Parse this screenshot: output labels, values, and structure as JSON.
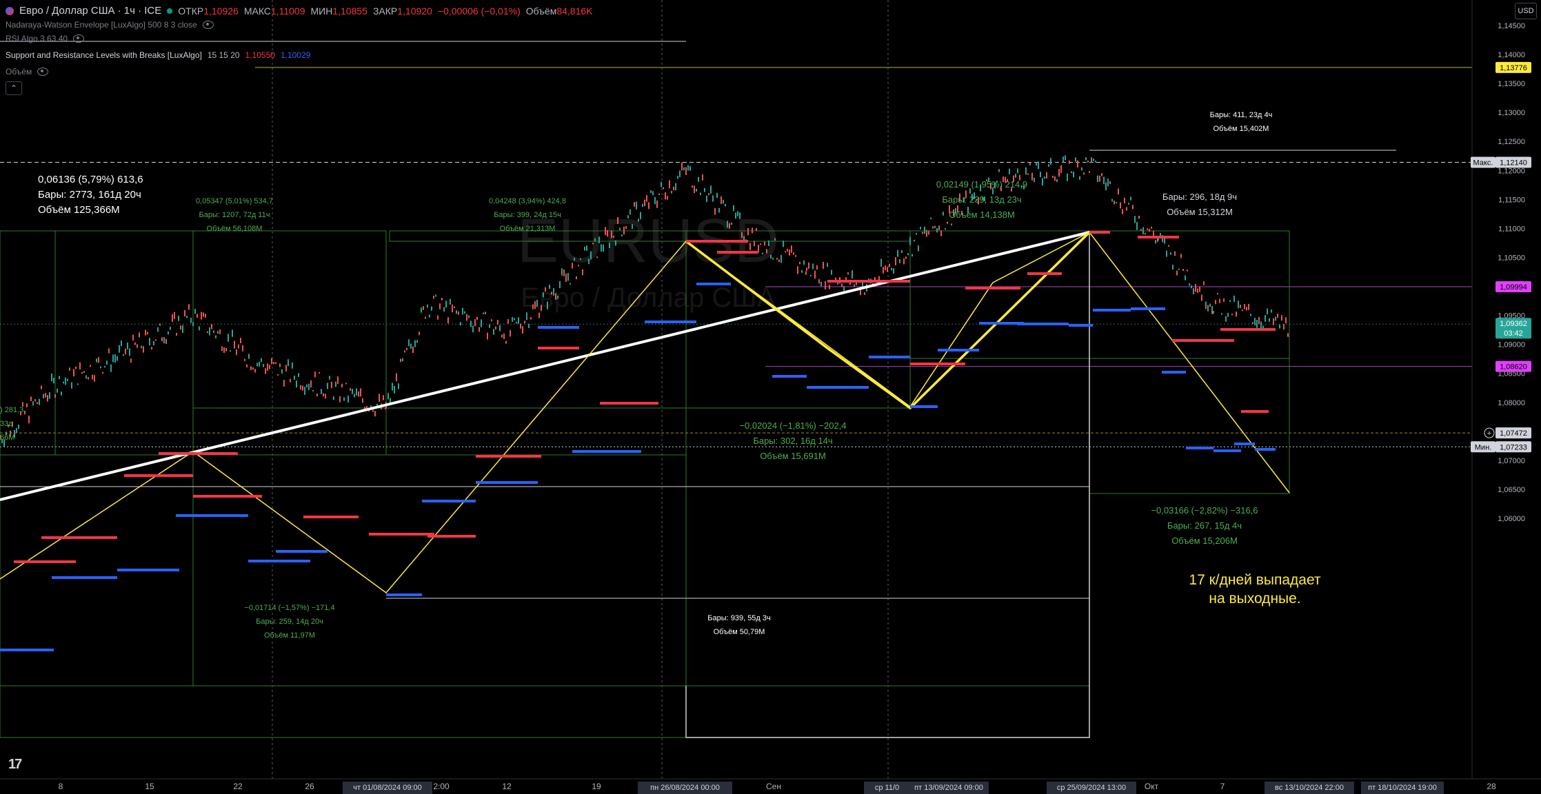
{
  "legend": {
    "symbol_title": "Евро / Доллар США · 1ч · ICE",
    "open_label": "ОТКР",
    "open_value": "1,10926",
    "high_label": "МАКС",
    "high_value": "1,11009",
    "low_label": "МИН",
    "low_value": "1,10855",
    "close_label": "ЗАКР",
    "close_value": "1,10920",
    "change_value": "−0,00006 (−0,01%)",
    "volume_label": "Объём",
    "volume_value": "84,816K",
    "indicators": [
      "Nadaraya-Watson Envelope [LuxAlgo] 500 8 3 close",
      "RSI Algo 3 63 40",
      "Support and Resistance Levels with Breaks [LuxAlgo]",
      "Объём"
    ],
    "sr_params": "15 15 20",
    "sr_val1": "1,10550",
    "sr_val2": "1,10029",
    "collapse_icon": "chevron-up-icon"
  },
  "currency_button": "USD",
  "annotation_note": [
    "17 к/дней выпадает",
    "на выходные."
  ],
  "measurements": [
    {
      "line1": "0,06136 (5,79%) 613,6",
      "line2": "Бары: 2773, 161д 20ч",
      "line3": "Объём 125,366M"
    },
    {
      "line1": "0,05347 (5,01%) 534,7",
      "line2": "Бары: 1207, 72д 11ч",
      "line3": "Объём 56,108M"
    },
    {
      "line1": "0,04248 (3,94%) 424,8",
      "line2": "Бары: 399, 24д 15ч",
      "line3": "Объём 21,313M"
    },
    {
      "line1": "0,02149 (1,95%) 214,9",
      "line2": "Бары: 239, 13д 23ч",
      "line3": "Объём 14,138M"
    },
    {
      "line1": "Бары: 411, 23д 4ч",
      "line2": "Объём 15,402M"
    },
    {
      "line1": "Бары: 296, 18д 9ч",
      "line2": "Объём 15,312M"
    },
    {
      "line1": "−0,02024 (−1,81%) −202,4",
      "line2": "Бары: 302, 16д 14ч",
      "line3": "Объём 15,691M"
    },
    {
      "line1": "−0,03166 (−2,82%) −316,6",
      "line2": "Бары: 267, 15д 4ч",
      "line3": "Объём 15,206M"
    },
    {
      "line1": "−0,01714 (−1,57%) −171,4",
      "line2": "Бары: 259, 14д 20ч",
      "line3": "Объём 11,97M"
    },
    {
      "line1": "Бары: 939, 55д 3ч",
      "line2": "Объём 50,79M"
    },
    {
      "line1": ") 281,3",
      "line2": "33д",
      "line3": "66M"
    }
  ],
  "price_scale": {
    "ticks": [
      "1,14500",
      "1,14000",
      "1,13500",
      "1,13000",
      "1,12500",
      "1,12000",
      "1,11500",
      "1,11000",
      "1,10500",
      "1,10000",
      "1,09500",
      "1,09000",
      "1,08500",
      "1,08000",
      "1,07500",
      "1,07000",
      "1,06500",
      "1,06000"
    ],
    "badges": [
      {
        "label": "",
        "value": "1,13776",
        "color": "#ffeb3b",
        "text_color": "#000000"
      },
      {
        "label": "Макс.",
        "value": "1,12140",
        "color": "#d1d4dc",
        "text_color": "#000000"
      },
      {
        "label": "",
        "value": "1,09994",
        "color": "#e040fb",
        "text_color": "#000000"
      },
      {
        "label": "",
        "value": "1,09362",
        "sub": "03:42",
        "color": "#26a69a",
        "text_color": "#ffffff"
      },
      {
        "label": "",
        "value": "1,08620",
        "color": "#e040fb",
        "text_color": "#000000"
      },
      {
        "label": "",
        "value": "1,07472",
        "color": "#d1d4dc",
        "text_color": "#000000"
      },
      {
        "label": "Мин.",
        "value": "1,07233",
        "color": "#d1d4dc",
        "text_color": "#000000"
      }
    ]
  },
  "time_scale": {
    "labels": [
      "8",
      "15",
      "22",
      "26",
      "2:00",
      "12",
      "19",
      "Сен",
      "Окт",
      "7",
      "28"
    ],
    "highlighted": [
      "чт 01/08/2024   09:00",
      "пн 26/08/2024   00:00",
      "ср 11/0",
      "пт 13/09/2024   09:00",
      "ср 25/09/2024   13:00",
      "вс 13/10/2024   22:00",
      "пт 18/10/2024   19:00"
    ]
  },
  "chart_data": {
    "type": "line",
    "title": "Евро / Доллар США · 1ч · ICE",
    "ylim": [
      1.058,
      1.148
    ],
    "y_ticks": [
      1.06,
      1.065,
      1.07,
      1.075,
      1.08,
      1.085,
      1.09,
      1.095,
      1.1,
      1.105,
      1.11,
      1.115,
      1.12,
      1.125,
      1.13,
      1.135,
      1.14,
      1.145
    ],
    "series": [
      {
        "values_comment": "",
        "x": [
          "2024-07-01",
          "2024-07-08",
          "2024-07-15",
          "2024-07-22",
          "2024-07-26",
          "2024-08-01",
          "2024-08-05",
          "2024-08-12",
          "2024-08-19",
          "2024-08-26",
          "2024-09-02",
          "2024-09-06",
          "2024-09-11",
          "2024-09-13",
          "2024-09-20",
          "2024-09-25",
          "2024-10-01",
          "2024-10-07",
          "2024-10-13"
        ],
        "values": [
          1.074,
          1.083,
          1.089,
          1.095,
          1.087,
          1.079,
          1.097,
          1.092,
          1.106,
          1.12,
          1.109,
          1.103,
          1.1,
          1.107,
          1.118,
          1.121,
          1.108,
          1.097,
          1.093
        ]
      }
    ],
    "max_price": 1.1214,
    "min_price": 1.07233,
    "last_price": 1.09362
  }
}
